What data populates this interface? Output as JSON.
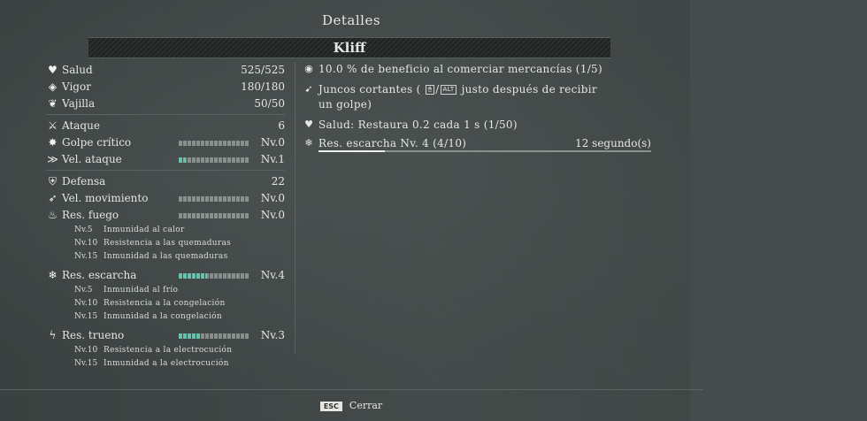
{
  "title": "Detalles",
  "character_name": "Kliff",
  "stats": {
    "salud": {
      "icon": "heart-plus-icon",
      "label": "Salud",
      "value": "525/525"
    },
    "vigor": {
      "icon": "vigor-icon",
      "label": "Vigor",
      "value": "180/180"
    },
    "vajilla": {
      "icon": "leaf-icon",
      "label": "Vajilla",
      "value": "50/50"
    },
    "ataque": {
      "icon": "sword-icon",
      "label": "Ataque",
      "value": "6"
    },
    "golpe_critico": {
      "icon": "critical-icon",
      "label": "Golpe crítico",
      "level": "Nv.0",
      "fill": 0
    },
    "vel_ataque": {
      "icon": "attack-speed-icon",
      "label": "Vel. ataque",
      "level": "Nv.1",
      "fill": 0.1
    },
    "defensa": {
      "icon": "shield-icon",
      "label": "Defensa",
      "value": "22"
    },
    "vel_movimiento": {
      "icon": "boot-icon",
      "label": "Vel. movimiento",
      "level": "Nv.0",
      "fill": 0
    },
    "res_fuego": {
      "icon": "fire-icon",
      "label": "Res. fuego",
      "level": "Nv.0",
      "fill": 0,
      "tiers": [
        {
          "level": "Nv.5",
          "text": "Inmunidad al calor"
        },
        {
          "level": "Nv.10",
          "text": "Resistencia a las quemaduras"
        },
        {
          "level": "Nv.15",
          "text": "Inmunidad a las quemaduras"
        }
      ]
    },
    "res_escarcha": {
      "icon": "snowflake-icon",
      "label": "Res. escarcha",
      "level": "Nv.4",
      "fill": 0.4,
      "tiers": [
        {
          "level": "Nv.5",
          "text": "Inmunidad al frío"
        },
        {
          "level": "Nv.10",
          "text": "Resistencia a la congelación"
        },
        {
          "level": "Nv.15",
          "text": "Inmunidad a la congelación"
        }
      ]
    },
    "res_trueno": {
      "icon": "lightning-icon",
      "label": "Res. trueno",
      "level": "Nv.3",
      "fill": 0.3,
      "tiers": [
        {
          "level": "Nv.10",
          "text": "Resistencia a la electrocución"
        },
        {
          "level": "Nv.15",
          "text": "Inmunidad a la electrocución"
        }
      ]
    }
  },
  "effects": {
    "comercio": {
      "icon": "coin-icon",
      "text": "10.0 % de beneficio al comerciar mercancías (1/5)"
    },
    "juncos": {
      "icon": "runner-icon",
      "text_a": "Juncos cortantes (",
      "text_b": "/",
      "text_c": "justo después de recibir",
      "text_d": "un golpe)",
      "key_mouse": "🖱",
      "key_alt": "ALT"
    },
    "salud_regen": {
      "icon": "heart-plus-icon",
      "text": "Salud: Restaura 0.2 cada 1 s (1/50)"
    },
    "res_escarcha": {
      "icon": "snowflake-icon",
      "text": "Res. escarcha Nv. 4 (4/10)",
      "timer": "12 segundo(s)",
      "progress": 0.2
    }
  },
  "footer": {
    "key": "ESC",
    "label": "Cerrar"
  },
  "colors": {
    "bar_fill": "#6fe0c6",
    "background": "#3b4240"
  }
}
